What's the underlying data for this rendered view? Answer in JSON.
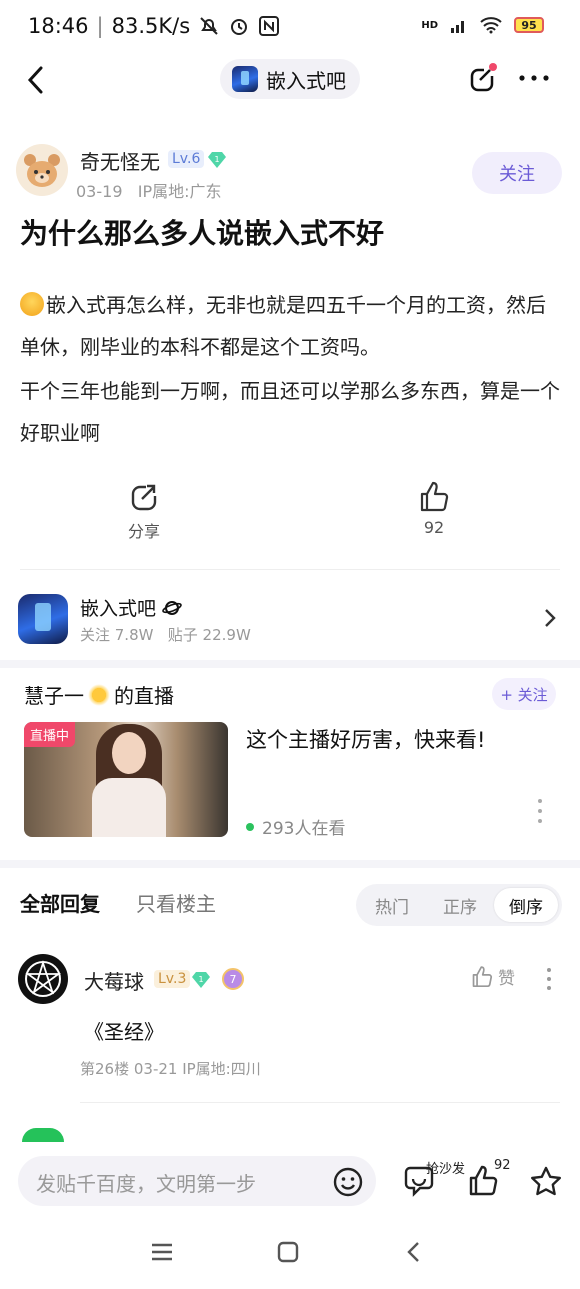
{
  "status": {
    "time": "18:46",
    "speed": "83.5K/s",
    "network": "HD",
    "battery": "95"
  },
  "nav": {
    "title": "嵌入式吧"
  },
  "author": {
    "name": "奇无怪无",
    "level": "Lv.6",
    "gem": "1",
    "date": "03-19",
    "ip": "IP属地:广东",
    "follow": "关注"
  },
  "post": {
    "title": "为什么那么多人说嵌入式不好",
    "paragraphs": [
      "嵌入式再怎么样，无非也就是四五千一个月的工资，然后单休，刚毕业的本科不都是这个工资吗。",
      "干个三年也能到一万啊，而且还可以学那么多东西，算是一个好职业啊"
    ]
  },
  "actions": {
    "share": "分享",
    "likes": "92"
  },
  "forum": {
    "name": "嵌入式吧",
    "follows": "关注 7.8W",
    "posts": "贴子 22.9W"
  },
  "live": {
    "host": "慧子一",
    "suffix": "的直播",
    "follow": "+ 关注",
    "badge": "直播中",
    "title": "这个主播好厉害，快来看!",
    "viewers": "293人在看"
  },
  "replies": {
    "tab_all": "全部回复",
    "tab_op": "只看楼主",
    "sort": [
      "热门",
      "正序",
      "倒序"
    ],
    "items": [
      {
        "name": "大莓球",
        "level": "Lv.3",
        "gem": "1",
        "badge": "7",
        "like": "赞",
        "text": "《圣经》",
        "meta": "第26楼   03-21   IP属地:四川"
      }
    ]
  },
  "bottom": {
    "placeholder": "发贴千百度，文明第一步",
    "sofa": "抢沙发",
    "likes": "92"
  },
  "colors": {
    "accent": "#6b5bd6",
    "live_badge": "#f0486a",
    "online_dot": "#2bc25e"
  }
}
